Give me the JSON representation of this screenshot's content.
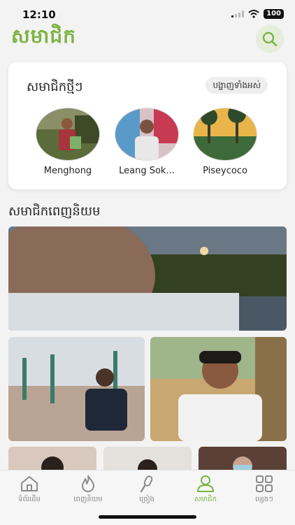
{
  "status_bar": {
    "time": "12:10",
    "battery": "100"
  },
  "header": {
    "title": "សមាជិក"
  },
  "new_members": {
    "title": "សមាជិកថ្មីៗ",
    "view_all_label": "បង្ហាញទាំងអស់",
    "members": [
      {
        "name": "Menghong"
      },
      {
        "name": "Leang Sok..."
      },
      {
        "name": "Piseycoco"
      }
    ]
  },
  "popular": {
    "title": "សមាជិកពេញនិយម"
  },
  "bottom_nav": {
    "items": [
      {
        "label": "ទំព័រដើម",
        "icon": "home-icon"
      },
      {
        "label": "ពេញនិយម",
        "icon": "flame-icon"
      },
      {
        "label": "ច្រៀង",
        "icon": "microphone-icon"
      },
      {
        "label": "សមាជិក",
        "icon": "person-icon",
        "active": true
      },
      {
        "label": "ម្សេងៗ",
        "icon": "grid-icon"
      }
    ]
  },
  "colors": {
    "accent": "#7cb342",
    "background": "#f3f3f3"
  }
}
